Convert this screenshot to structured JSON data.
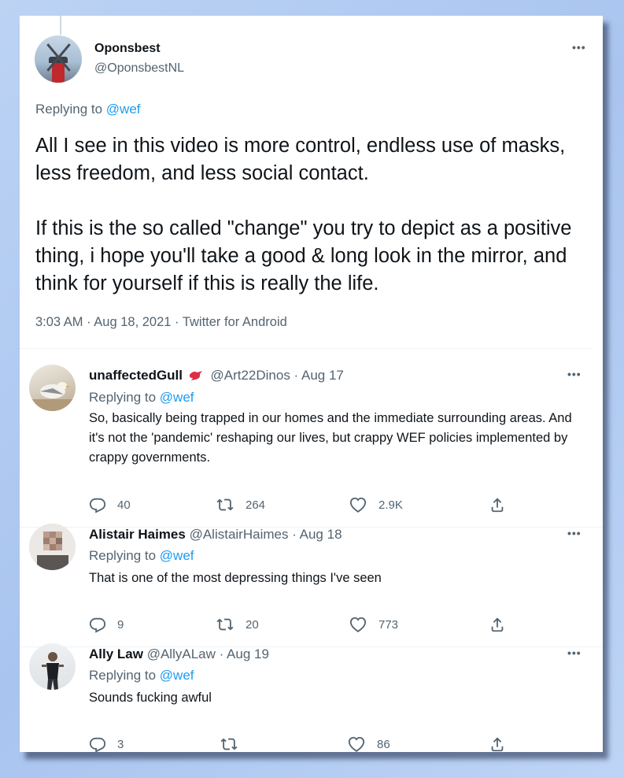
{
  "main": {
    "name": "Oponsbest",
    "handle": "@OponsbestNL",
    "replying_prefix": "Replying to ",
    "replying_to": "@wef",
    "text": "All I see in this video is more control, endless use of masks, less freedom, and less social contact.\n\nIf this is the so called \"change\" you try to depict as a positive thing, i hope you'll take a good & long look in the mirror, and think for yourself if this is really the life.",
    "meta": "3:03 AM · Aug 18, 2021 · Twitter for Android"
  },
  "more_label": "•••",
  "replies": [
    {
      "name": "unaffectedGull",
      "handle_date": "@Art22Dinos · Aug 17",
      "replying_prefix": "Replying to ",
      "replying_to": "@wef",
      "text": "So, basically being trapped in our homes and the immediate surrounding areas. And it's not the 'pandemic' reshaping our lives, but crappy WEF policies implemented by crappy governments.",
      "replies_count": "40",
      "retweets_count": "264",
      "likes_count": "2.9K"
    },
    {
      "name": "Alistair Haimes",
      "handle_date": "@AlistairHaimes · Aug 18",
      "replying_prefix": "Replying to ",
      "replying_to": "@wef",
      "text": "That is one of the most depressing things I've seen",
      "replies_count": "9",
      "retweets_count": "20",
      "likes_count": "773"
    },
    {
      "name": "Ally Law",
      "handle_date": "@AllyALaw · Aug 19",
      "replying_prefix": "Replying to ",
      "replying_to": "@wef",
      "text": "Sounds fucking awful",
      "replies_count": "3",
      "retweets_count": "",
      "likes_count": "86"
    }
  ],
  "icons": {
    "reply": "reply-icon",
    "retweet": "retweet-icon",
    "like": "heart-icon",
    "share": "share-icon",
    "more": "more-icon",
    "badge": "red-bird-emoji"
  },
  "colors": {
    "link": "#1d9bf0",
    "muted": "#536471",
    "text": "#0f1419",
    "background": "#b4cdf2"
  }
}
